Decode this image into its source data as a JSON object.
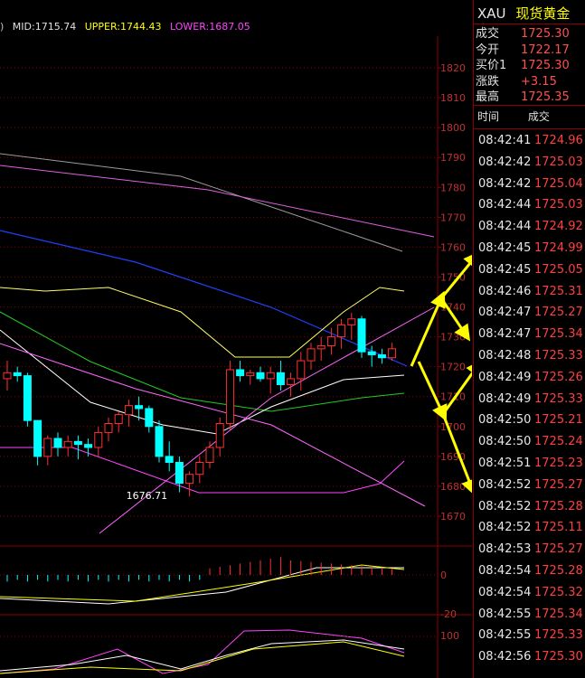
{
  "legend": {
    "prefix": ")",
    "mid": "MID:1715.74",
    "upper": "UPPER:1744.43",
    "lower": "LOWER:1687.05"
  },
  "axis": {
    "price_ticks": [
      "1820",
      "1810",
      "1800",
      "1790",
      "1780",
      "1770",
      "1760",
      "1750",
      "1740",
      "1730",
      "1720",
      "1710",
      "1700",
      "1690",
      "1680",
      "1670"
    ],
    "macd_ticks": [
      "0",
      "-20"
    ],
    "rsi_ticks": [
      "100"
    ],
    "low_label": "1676.71"
  },
  "colors": {
    "up": "#ff3030",
    "down": "#00ffff",
    "axis": "#8b0000",
    "mid": "#0030ff",
    "upper": "#ffff66",
    "lower": "#ff00ff",
    "arrow": "#ffff00"
  },
  "chart_data": {
    "type": "candlestick",
    "y_range": [
      1665,
      1825
    ],
    "candles": [
      [
        1716,
        1722,
        1712,
        1718
      ],
      [
        1718,
        1720,
        1715,
        1717
      ],
      [
        1717,
        1718,
        1700,
        1702
      ],
      [
        1702,
        1702,
        1687,
        1690
      ],
      [
        1690,
        1697,
        1687,
        1696
      ],
      [
        1696,
        1698,
        1690,
        1693
      ],
      [
        1693,
        1697,
        1690,
        1695
      ],
      [
        1695,
        1697,
        1689,
        1694
      ],
      [
        1694,
        1696,
        1690,
        1693
      ],
      [
        1693,
        1700,
        1690,
        1698
      ],
      [
        1698,
        1703,
        1695,
        1701
      ],
      [
        1701,
        1705,
        1698,
        1704
      ],
      [
        1704,
        1709,
        1700,
        1707
      ],
      [
        1707,
        1710,
        1702,
        1706
      ],
      [
        1706,
        1707,
        1698,
        1700
      ],
      [
        1700,
        1702,
        1688,
        1690
      ],
      [
        1690,
        1695,
        1685,
        1688
      ],
      [
        1688,
        1690,
        1678,
        1681
      ],
      [
        1681,
        1685,
        1676.71,
        1684
      ],
      [
        1684,
        1690,
        1681,
        1688
      ],
      [
        1688,
        1695,
        1686,
        1693
      ],
      [
        1693,
        1703,
        1690,
        1701
      ],
      [
        1701,
        1722,
        1699,
        1719
      ],
      [
        1719,
        1722,
        1715,
        1717
      ],
      [
        1717,
        1719,
        1714,
        1718
      ],
      [
        1718,
        1720,
        1715,
        1716
      ],
      [
        1716,
        1720,
        1711,
        1718
      ],
      [
        1718,
        1722,
        1712,
        1714
      ],
      [
        1714,
        1718,
        1710,
        1716
      ],
      [
        1716,
        1725,
        1712,
        1722
      ],
      [
        1722,
        1728,
        1719,
        1726
      ],
      [
        1726,
        1730,
        1722,
        1727
      ],
      [
        1727,
        1733,
        1724,
        1730
      ],
      [
        1730,
        1736,
        1726,
        1734
      ],
      [
        1734,
        1738,
        1729,
        1736
      ],
      [
        1736,
        1737,
        1723,
        1725
      ],
      [
        1725,
        1727,
        1720,
        1724
      ],
      [
        1724,
        1726,
        1721,
        1723
      ],
      [
        1723,
        1728,
        1722,
        1726
      ]
    ]
  },
  "quote": {
    "symbol": "XAU",
    "name": "现货黄金",
    "rows": [
      {
        "label": "成交",
        "value": "1725.30"
      },
      {
        "label": "今开",
        "value": "1722.17"
      },
      {
        "label": "买价1",
        "value": "1725.30"
      },
      {
        "label": "涨跌",
        "value": "+3.15"
      },
      {
        "label": "最高",
        "value": "1725.35"
      }
    ]
  },
  "ticks_header": {
    "time": "时间",
    "price": "成交"
  },
  "ticks": [
    {
      "time": "08:42:41",
      "price": "1724.96"
    },
    {
      "time": "08:42:42",
      "price": "1725.03"
    },
    {
      "time": "08:42:42",
      "price": "1725.04"
    },
    {
      "time": "08:42:44",
      "price": "1725.03"
    },
    {
      "time": "08:42:44",
      "price": "1724.92"
    },
    {
      "time": "08:42:45",
      "price": "1724.99"
    },
    {
      "time": "08:42:45",
      "price": "1725.05"
    },
    {
      "time": "08:42:46",
      "price": "1725.31"
    },
    {
      "time": "08:42:47",
      "price": "1725.27"
    },
    {
      "time": "08:42:47",
      "price": "1725.34"
    },
    {
      "time": "08:42:48",
      "price": "1725.33"
    },
    {
      "time": "08:42:49",
      "price": "1725.26"
    },
    {
      "time": "08:42:49",
      "price": "1725.33"
    },
    {
      "time": "08:42:50",
      "price": "1725.21"
    },
    {
      "time": "08:42:50",
      "price": "1725.24"
    },
    {
      "time": "08:42:51",
      "price": "1725.23"
    },
    {
      "time": "08:42:52",
      "price": "1725.27"
    },
    {
      "time": "08:42:52",
      "price": "1725.28"
    },
    {
      "time": "08:42:52",
      "price": "1725.11"
    },
    {
      "time": "08:42:53",
      "price": "1725.27"
    },
    {
      "time": "08:42:54",
      "price": "1725.28"
    },
    {
      "time": "08:42:54",
      "price": "1725.32"
    },
    {
      "time": "08:42:55",
      "price": "1725.34"
    },
    {
      "time": "08:42:55",
      "price": "1725.33"
    },
    {
      "time": "08:42:56",
      "price": "1725.30"
    }
  ]
}
